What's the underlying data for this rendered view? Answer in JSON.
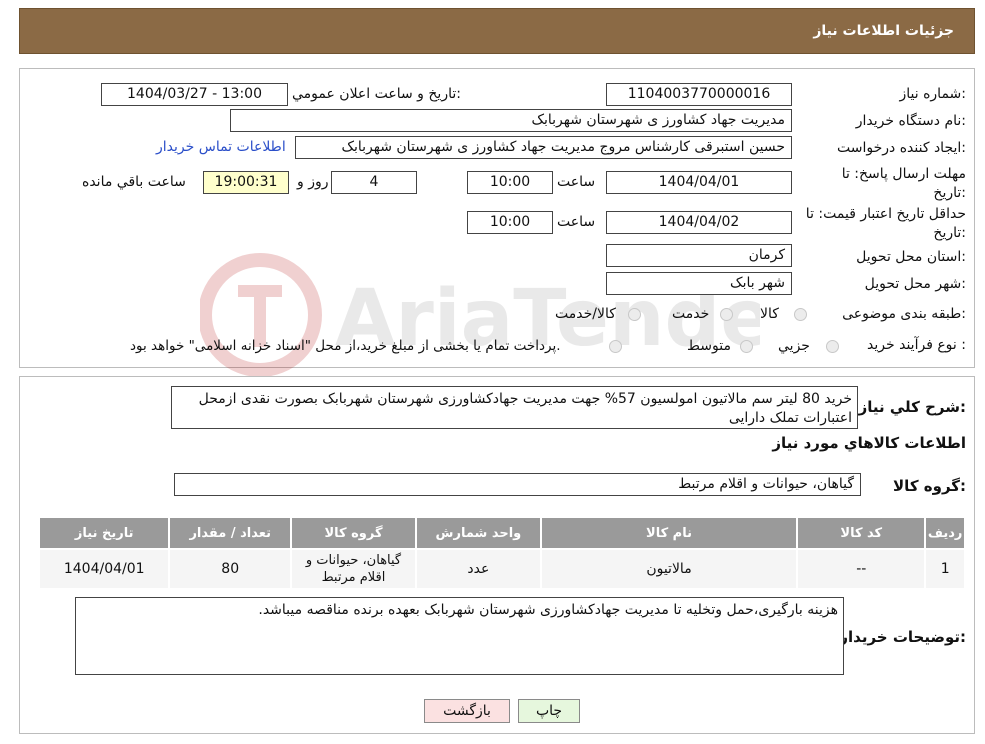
{
  "header": {
    "title": "جزئیات اطلاعات نیاز"
  },
  "form": {
    "need_number_label": "شماره نیاز:",
    "need_number": "1104003770000016",
    "announce_label": "تاریخ و ساعت اعلان عمومي:",
    "announce_value": "1404/03/27 - 13:00",
    "buyer_label": "نام دستگاه خریدار:",
    "buyer_value": "مدیریت جهاد کشاورز ی شهرستان شهربابک",
    "creator_label": "ایجاد کننده درخواست:",
    "creator_value": "حسین استبرقی کارشناس مروج مدیریت جهاد کشاورز ی شهرستان شهربابک",
    "contact_link": "اطلاعات تماس خریدار",
    "deadline_label": "مهلت ارسال پاسخ: تا تاریخ:",
    "deadline_date": "1404/04/01",
    "time_label": "ساعت",
    "deadline_time": "10:00",
    "days_value": "4",
    "days_label": "روز و",
    "remaining_time": "19:00:31",
    "remaining_label": "ساعت باقي مانده",
    "validity_label": "حداقل تاریخ اعتبار قیمت: تا تاریخ:",
    "validity_date": "1404/04/02",
    "validity_time": "10:00",
    "province_label": "استان محل تحویل:",
    "province_value": "کرمان",
    "city_label": "شهر محل تحویل:",
    "city_value": "شهر بابک",
    "category_label": "طبقه بندی موضوعی:",
    "category_options": [
      "کالا",
      "خدمت",
      "کالا/خدمت"
    ],
    "process_label": "نوع فرآیند خرید :",
    "process_options": [
      "جزیي",
      "متوسط"
    ],
    "process_note": "پرداخت تمام یا بخشی از مبلغ خرید،از محل \"اسناد خزانه اسلامی\" خواهد بود."
  },
  "description": {
    "label": "شرح کلي نیاز:",
    "text": "خرید 80 لیتر سم مالاتیون امولسیون 57% جهت مدیریت جهادکشاورزی شهرستان شهربابک بصورت نقدی ازمحل اعتبارات تملک دارایی"
  },
  "goods": {
    "section_title": "اطلاعات کالاهاي مورد نیاز",
    "group_label": "گروه کالا:",
    "group_value": "گیاهان، حیوانات و اقلام مرتبط",
    "columns": [
      "ردیف",
      "کد کالا",
      "نام کالا",
      "واحد شمارش",
      "گروه کالا",
      "تعداد / مقدار",
      "تاریخ نیاز"
    ],
    "rows": [
      [
        "1",
        "--",
        "مالاتیون",
        "عدد",
        "گیاهان، حیوانات و اقلام مرتبط",
        "80",
        "1404/04/01"
      ]
    ]
  },
  "buyer_notes": {
    "label": "توضیحات خریدار:",
    "text": "هزینه بارگیری،حمل وتخلیه تا مدیریت جهادکشاورزی شهرستان شهربابک بعهده برنده مناقصه میباشد."
  },
  "buttons": {
    "print": "چاپ",
    "back": "بازگشت"
  },
  "watermark": {
    "text": "AriaTender.neT"
  },
  "colors": {
    "header": "#8b6a45",
    "time_bg": "#ffffcc",
    "link": "#2b4fc9",
    "print_bg": "#e6f7dd",
    "back_bg": "#fbe1e1"
  }
}
